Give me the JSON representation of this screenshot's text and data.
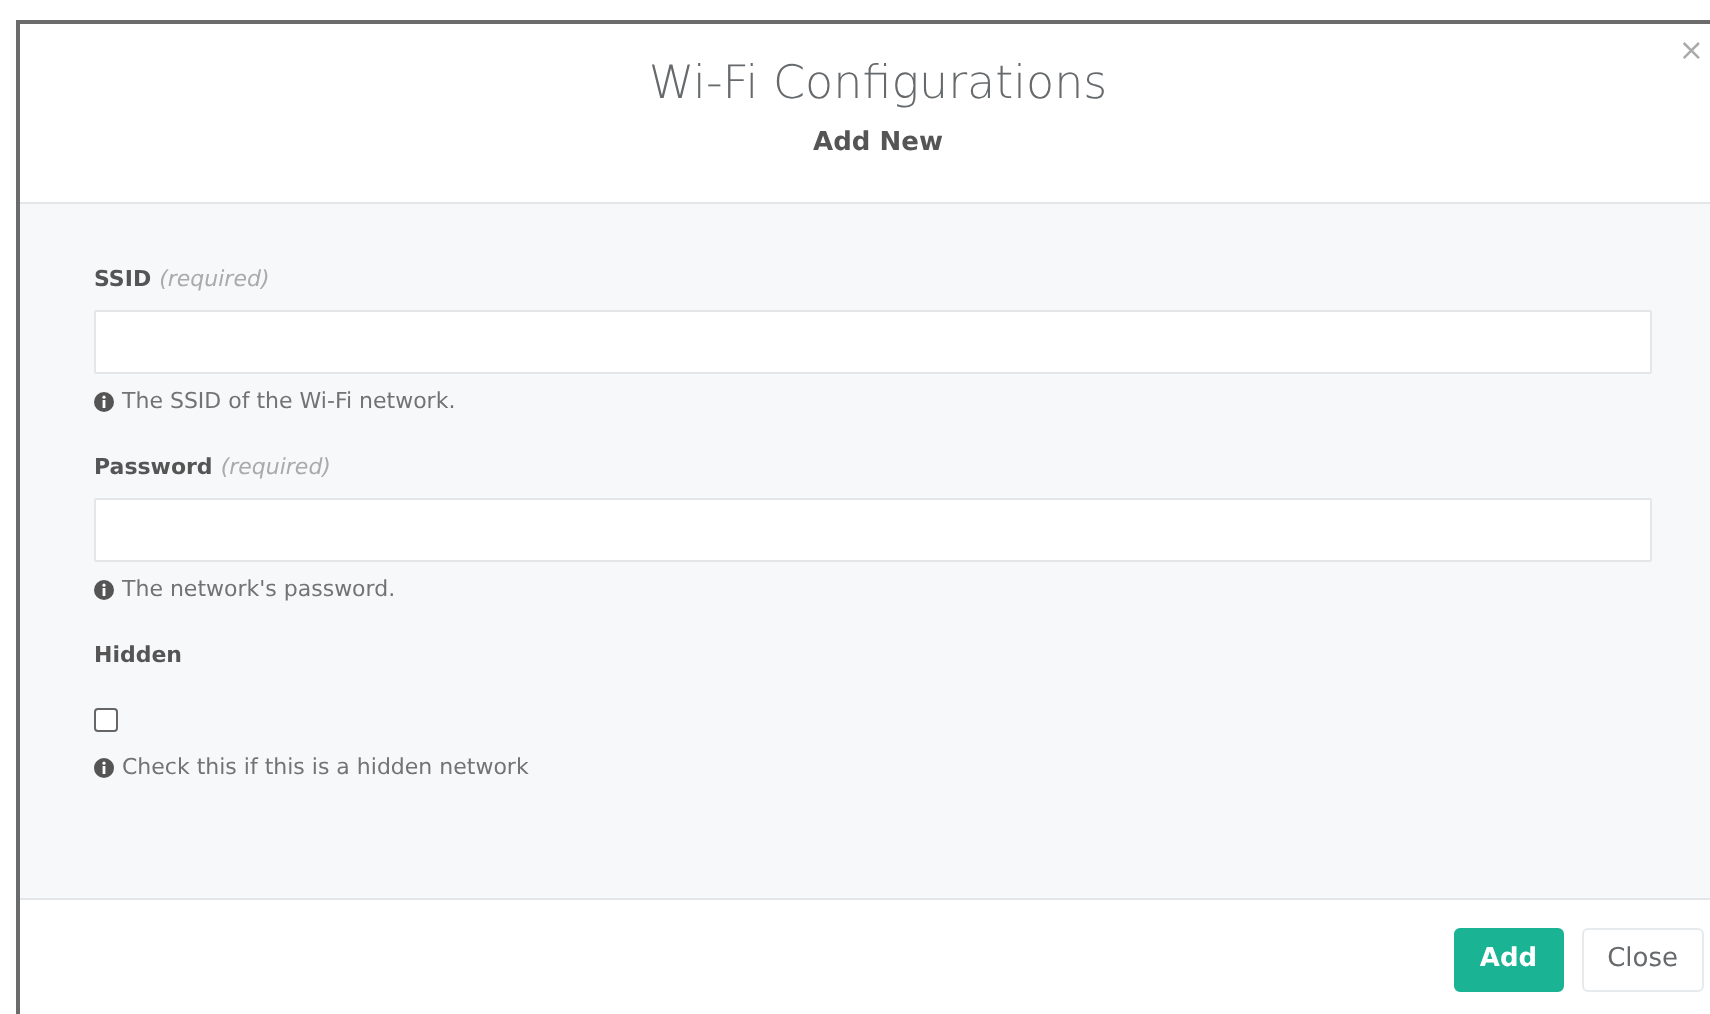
{
  "dialog": {
    "title": "Wi-Fi Configurations",
    "subtitle": "Add New",
    "close_glyph": "×"
  },
  "fields": [
    {
      "kind": "text",
      "label": "SSID",
      "note": "(required)",
      "help": "The SSID of the Wi-Fi network."
    },
    {
      "kind": "text",
      "label": "Password",
      "note": "(required)",
      "help": "The network's password."
    },
    {
      "kind": "checkbox",
      "label": "Hidden",
      "checked": false,
      "help": "Check this if this is a hidden network"
    }
  ],
  "buttons": [
    {
      "label": "Add",
      "kind": "primary"
    },
    {
      "label": "Close",
      "kind": "secondary"
    }
  ]
}
